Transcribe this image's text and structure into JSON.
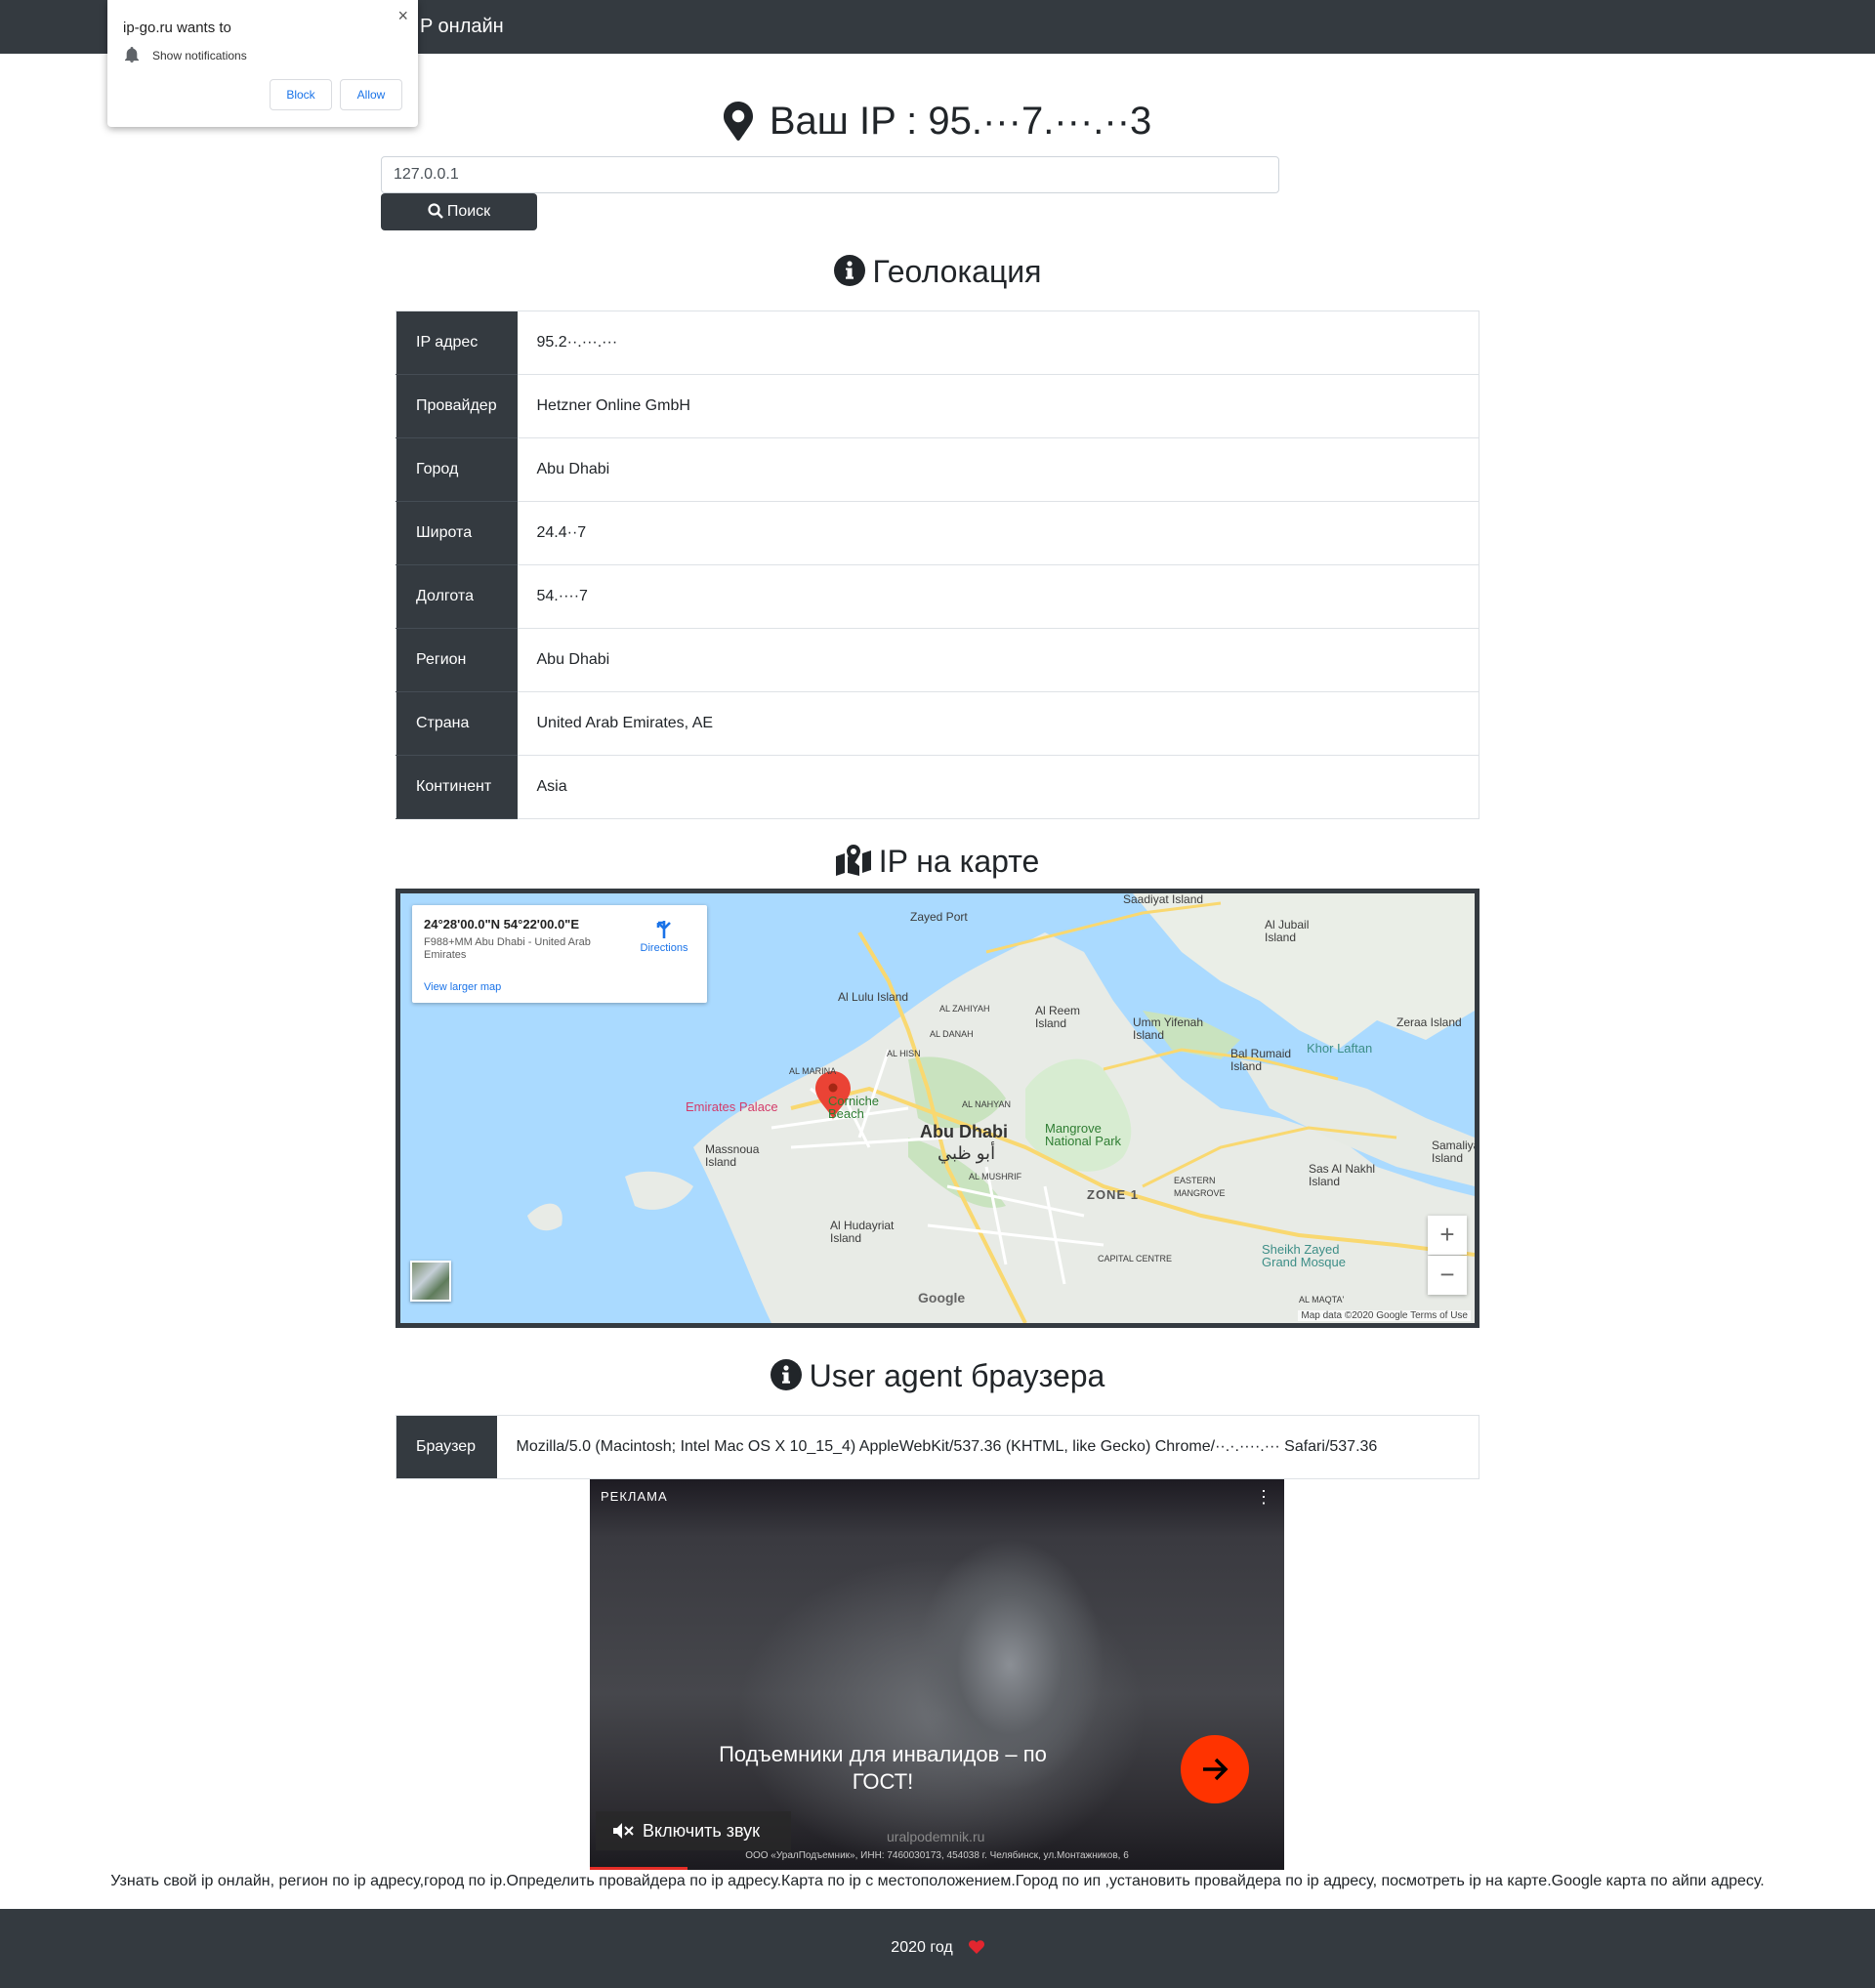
{
  "navbar": {
    "brand": "P онлайн"
  },
  "notification": {
    "title": "ip-go.ru wants to",
    "permission": "Show notifications",
    "block_label": "Block",
    "allow_label": "Allow",
    "close_label": "×"
  },
  "ip_header": {
    "text": "Ваш IP : 95.···7.···.··3"
  },
  "search": {
    "value": "127.0.0.1",
    "button_label": "Поиск"
  },
  "geo": {
    "title": "Геолокация",
    "rows": [
      {
        "label": "IP адрес",
        "value": "95.2··.···.···"
      },
      {
        "label": "Провайдер",
        "value": "Hetzner Online GmbH"
      },
      {
        "label": "Город",
        "value": "Abu Dhabi"
      },
      {
        "label": "Широта",
        "value": "24.4··7"
      },
      {
        "label": "Долгота",
        "value": "54.····7"
      },
      {
        "label": "Регион",
        "value": "Abu Dhabi"
      },
      {
        "label": "Страна",
        "value": "United Arab Emirates, AE"
      },
      {
        "label": "Континент",
        "value": "Asia"
      }
    ]
  },
  "map": {
    "title": "IP на карте",
    "card": {
      "coords": "24°28'00.0\"N 54°22'00.0\"E",
      "address": "F988+MM Abu Dhabi - United Arab Emirates",
      "directions": "Directions",
      "larger": "View larger map"
    },
    "labels": {
      "city": "Abu Dhabi",
      "city_ar": "أبو ظبي",
      "zone": "ZONE 1",
      "capital": "CAPITAL CENTRE",
      "palace": "Emirates Palace",
      "corniche": "Corniche Beach",
      "mangrove": "Mangrove National Park",
      "mosque": "Sheikh Zayed Grand Mosque",
      "zayed_port": "Zayed Port",
      "saadiyat": "Saadiyat Island",
      "jubail": "Al Jubail Island",
      "lulu": "Al Lulu Island",
      "reem": "Al Reem Island",
      "umm": "Umm Yifenah Island",
      "rumaid": "Bal Rumaid Island",
      "zeraa": "Zeraa Island",
      "massnoua": "Massnoua Island",
      "hudayriat": "Al Hudayriat Island",
      "sas": "Sas Al Nakhl Island",
      "samaliya": "Samaliya Island",
      "khor_laftan": "Khor Laftan",
      "zahiyah": "AL ZAHIYAH",
      "danah": "AL DANAH",
      "hisn": "AL HISN",
      "marina": "AL MARINA",
      "nahyan": "AL NAHYAN",
      "mushrif": "AL MUSHRIF",
      "maqta": "AL MAQTA'",
      "eastern": "EASTERN MANGROVE"
    },
    "zoom_in": "+",
    "zoom_out": "−",
    "google": "Google",
    "attribution": "Map data ©2020 Google   Terms of Use"
  },
  "ua": {
    "title": "User agent браузера",
    "label": "Браузер",
    "value": "Mozilla/5.0 (Macintosh; Intel Mac OS X 10_15_4) AppleWebKit/537.36 (KHTML, like Gecko) Chrome/··.·.····.··· Safari/537.36"
  },
  "ad": {
    "label": "РЕКЛАМА",
    "menu": "⋮",
    "headline": "Подъемники для инвалидов – по ГОСТ!",
    "sound": "Включить звук",
    "domain": "uralpodemnik.ru",
    "legal": "ООО «УралПодъемник», ИНН: 7460030173, 454038 г. Челябинск, ул.Монтажников, 6",
    "progress": 0.14
  },
  "seo_text": "Узнать свой ip онлайн, регион по ip адресу,город по ip.Определить провайдера по ip адресу.Карта по ip с местоположением.Город по ип ,установить провайдера по ip адресу, посмотреть ip на карте.Google карта по айпи адресу.",
  "footer": {
    "year": "2020 год"
  },
  "colors": {
    "dark": "#343a40",
    "accent_red": "#ff3300",
    "heart": "#e3262f",
    "water": "#aadaff"
  }
}
